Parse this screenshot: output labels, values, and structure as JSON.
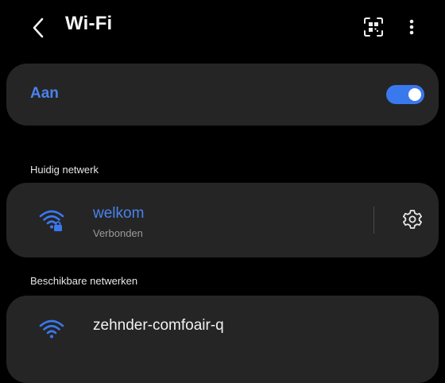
{
  "header": {
    "title": "Wi-Fi",
    "back_icon": "chevron-left-icon",
    "qr_icon": "qr-scan-icon",
    "more_icon": "more-vertical-icon"
  },
  "wifi_toggle": {
    "label": "Aan",
    "enabled": true
  },
  "current_network": {
    "section_label": "Huidig netwerk",
    "name": "welkom",
    "status": "Verbonden",
    "icon": "wifi-locked-icon",
    "settings_icon": "gear-icon"
  },
  "available_networks": {
    "section_label": "Beschikbare netwerken",
    "items": [
      {
        "name": "zehnder-comfoair-q",
        "icon": "wifi-icon"
      }
    ]
  },
  "colors": {
    "background": "#000000",
    "card": "#252525",
    "accent": "#4a82ee",
    "text": "#f2f2f2",
    "secondary_text": "#9a9a9a"
  }
}
